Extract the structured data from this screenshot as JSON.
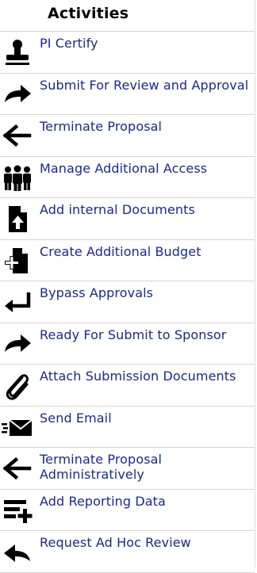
{
  "panel": {
    "title": "Activities",
    "items": [
      {
        "label": "PI Certify",
        "icon": "stamp-icon"
      },
      {
        "label": "Submit For Review and Approval",
        "icon": "arrow-right-icon"
      },
      {
        "label": "Terminate Proposal",
        "icon": "arrow-left-icon"
      },
      {
        "label": "Manage Additional Access",
        "icon": "group-users-icon"
      },
      {
        "label": "Add internal Documents",
        "icon": "document-add-icon"
      },
      {
        "label": "Create Additional Budget",
        "icon": "budget-add-icon"
      },
      {
        "label": "Bypass Approvals",
        "icon": "return-arrow-icon"
      },
      {
        "label": "Ready For Submit to Sponsor",
        "icon": "arrow-right-icon"
      },
      {
        "label": "Attach Submission Documents",
        "icon": "paperclip-icon"
      },
      {
        "label": "Send Email",
        "icon": "send-email-icon"
      },
      {
        "label": "Terminate Proposal Administratively",
        "icon": "arrow-left-icon"
      },
      {
        "label": "Add Reporting Data",
        "icon": "list-add-icon"
      },
      {
        "label": "Request Ad Hoc Review",
        "icon": "reply-arrow-icon"
      }
    ]
  },
  "colors": {
    "link": "#1b2a86",
    "icon": "#000000",
    "divider": "#d4d4d4"
  }
}
